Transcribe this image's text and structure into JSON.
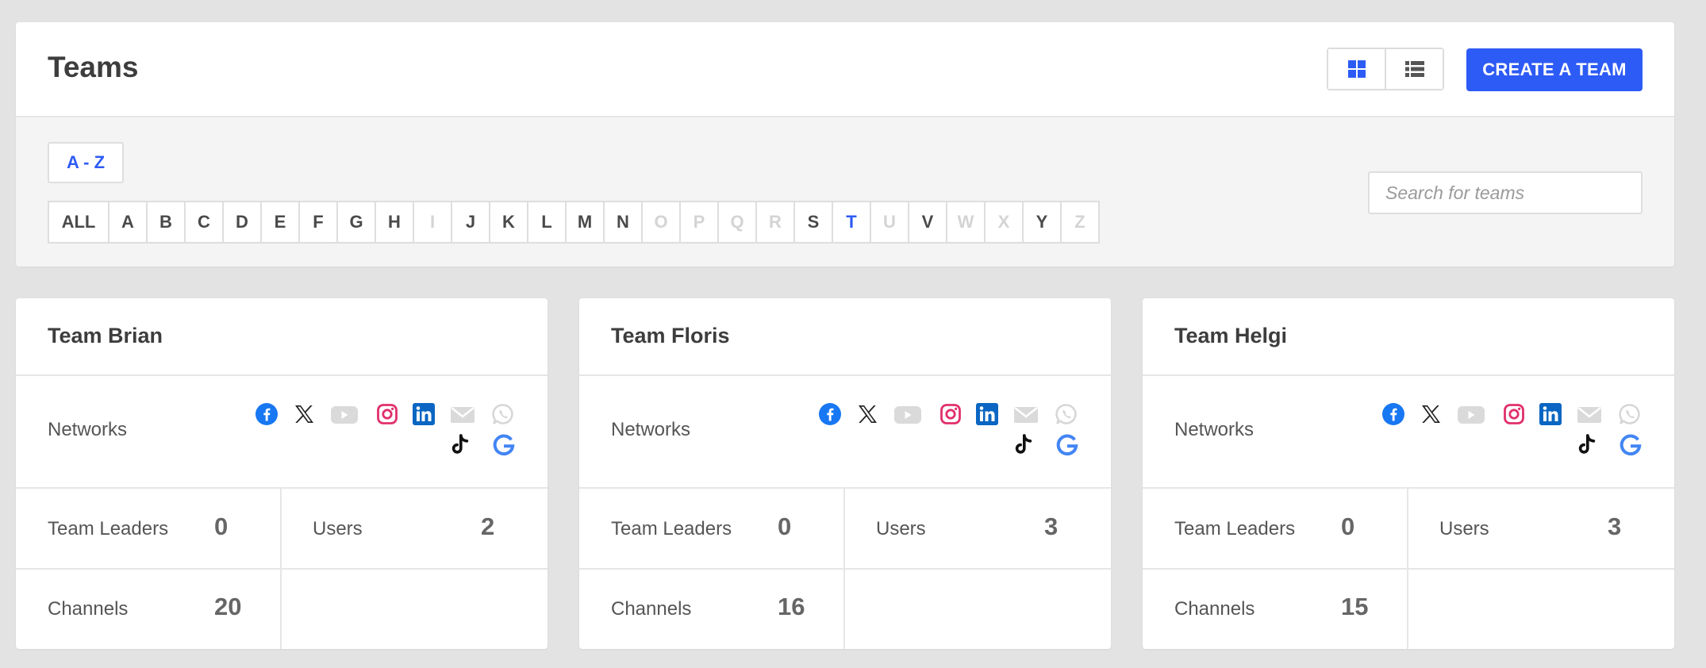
{
  "page": {
    "title": "Teams",
    "create_button": "CREATE A TEAM",
    "sort_label": "A - Z",
    "search_placeholder": "Search for teams",
    "active_letter": "T",
    "accent_color": "#2d5bf5"
  },
  "alphabet": [
    {
      "label": "ALL",
      "enabled": true
    },
    {
      "label": "A",
      "enabled": true
    },
    {
      "label": "B",
      "enabled": true
    },
    {
      "label": "C",
      "enabled": true
    },
    {
      "label": "D",
      "enabled": true
    },
    {
      "label": "E",
      "enabled": true
    },
    {
      "label": "F",
      "enabled": true
    },
    {
      "label": "G",
      "enabled": true
    },
    {
      "label": "H",
      "enabled": true
    },
    {
      "label": "I",
      "enabled": false
    },
    {
      "label": "J",
      "enabled": true
    },
    {
      "label": "K",
      "enabled": true
    },
    {
      "label": "L",
      "enabled": true
    },
    {
      "label": "M",
      "enabled": true
    },
    {
      "label": "N",
      "enabled": true
    },
    {
      "label": "O",
      "enabled": false
    },
    {
      "label": "P",
      "enabled": false
    },
    {
      "label": "Q",
      "enabled": false
    },
    {
      "label": "R",
      "enabled": false
    },
    {
      "label": "S",
      "enabled": true
    },
    {
      "label": "T",
      "enabled": true
    },
    {
      "label": "U",
      "enabled": false
    },
    {
      "label": "V",
      "enabled": true
    },
    {
      "label": "W",
      "enabled": false
    },
    {
      "label": "X",
      "enabled": false
    },
    {
      "label": "Y",
      "enabled": true
    },
    {
      "label": "Z",
      "enabled": false
    }
  ],
  "labels": {
    "networks": "Networks",
    "team_leaders": "Team Leaders",
    "users": "Users",
    "channels": "Channels"
  },
  "network_icons": [
    {
      "name": "facebook-icon",
      "active": true
    },
    {
      "name": "x-icon",
      "active": true
    },
    {
      "name": "youtube-icon",
      "active": false
    },
    {
      "name": "instagram-icon",
      "active": true
    },
    {
      "name": "linkedin-icon",
      "active": true
    },
    {
      "name": "email-icon",
      "active": false
    },
    {
      "name": "whatsapp-icon",
      "active": false
    },
    {
      "name": "tiktok-icon",
      "active": true
    },
    {
      "name": "google-icon",
      "active": true
    }
  ],
  "teams": [
    {
      "name": "Team Brian",
      "team_leaders": "0",
      "users": "2",
      "channels": "20"
    },
    {
      "name": "Team Floris",
      "team_leaders": "0",
      "users": "3",
      "channels": "16"
    },
    {
      "name": "Team Helgi",
      "team_leaders": "0",
      "users": "3",
      "channels": "15"
    }
  ]
}
